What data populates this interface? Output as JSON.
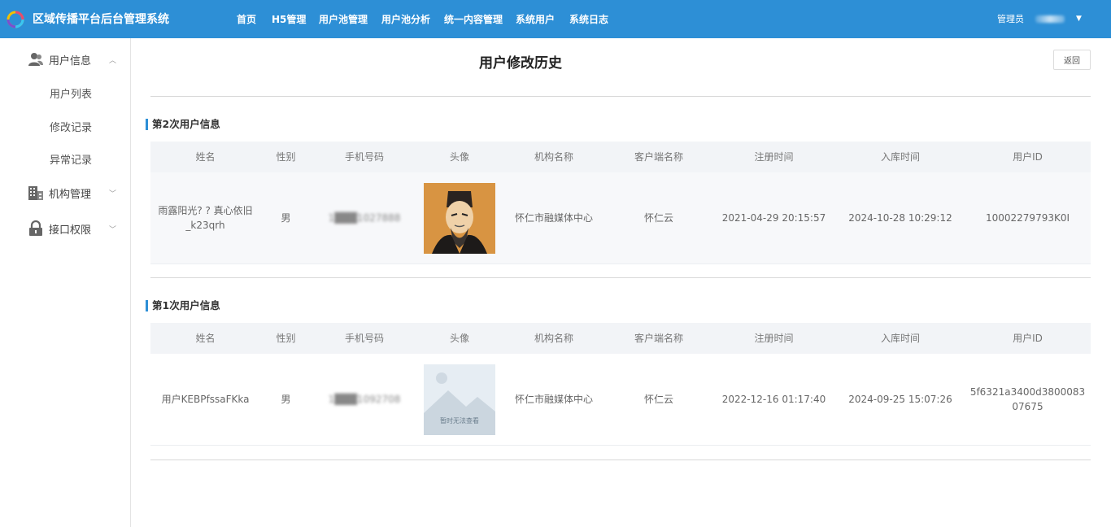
{
  "app": {
    "title": "区域传播平台后台管理系统"
  },
  "nav": [
    "首页",
    "H5管理",
    "用户池管理",
    "用户池分析",
    "统一内容管理",
    "系统用户",
    "系统日志"
  ],
  "user": {
    "role": "管理员",
    "name": "██████"
  },
  "sidebar": {
    "groups": [
      {
        "label": "用户信息",
        "icon": "user-icon",
        "expanded": true,
        "items": [
          "用户列表",
          "修改记录",
          "异常记录"
        ]
      },
      {
        "label": "机构管理",
        "icon": "building-icon",
        "expanded": false
      },
      {
        "label": "接口权限",
        "icon": "lock-icon",
        "expanded": false
      }
    ]
  },
  "page": {
    "title": "用户修改历史",
    "back_label": "返回"
  },
  "columns": [
    "姓名",
    "性别",
    "手机号码",
    "头像",
    "机构名称",
    "客户端名称",
    "注册时间",
    "入库时间",
    "用户ID"
  ],
  "sections": [
    {
      "title": "第2次用户信息",
      "row": {
        "name": "雨露阳光? ? 真心依旧_k23qrh",
        "gender": "男",
        "phone": "1███1027888",
        "avatar": "portrait-avatar",
        "org": "怀仁市融媒体中心",
        "client": "怀仁云",
        "register_time": "2021-04-29 20:15:57",
        "import_time": "2024-10-28 10:29:12",
        "user_id": "10002279793K0I"
      }
    },
    {
      "title": "第1次用户信息",
      "row": {
        "name": "用户KEBPfssaFKka",
        "gender": "男",
        "phone": "1███1092708",
        "avatar": "placeholder-avatar",
        "avatar_text": "暂时无法查看",
        "org": "怀仁市融媒体中心",
        "client": "怀仁云",
        "register_time": "2022-12-16 01:17:40",
        "import_time": "2024-09-25 15:07:26",
        "user_id": "5f6321a3400d380008307675"
      }
    }
  ],
  "colors": {
    "topbar": "#2d8fd6",
    "accent": "#2d8fd6"
  }
}
